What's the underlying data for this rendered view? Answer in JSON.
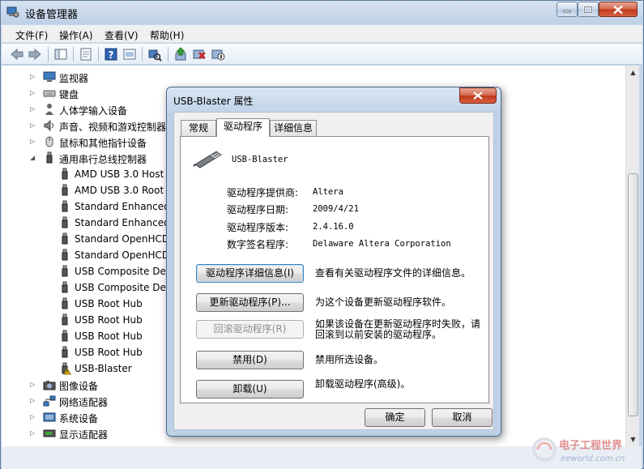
{
  "window": {
    "title": "设备管理器",
    "menu": [
      "文件(F)",
      "操作(A)",
      "查看(V)",
      "帮助(H)"
    ]
  },
  "tree": {
    "categories_top": [
      {
        "label": "监视器",
        "icon": "monitor-icon",
        "expanded": false
      },
      {
        "label": "键盘",
        "icon": "keyboard-icon",
        "expanded": false
      },
      {
        "label": "人体学输入设备",
        "icon": "hid-icon",
        "expanded": false
      },
      {
        "label": "声音、视频和游戏控制器",
        "icon": "sound-icon",
        "expanded": false
      },
      {
        "label": "鼠标和其他指针设备",
        "icon": "mouse-icon",
        "expanded": false
      },
      {
        "label": "通用串行总线控制器",
        "icon": "usb-controller-icon",
        "expanded": true
      }
    ],
    "usb_children": [
      "AMD USB 3.0 Host",
      "AMD USB 3.0 Root",
      "Standard Enhanced",
      "Standard Enhanced",
      "Standard OpenHCD",
      "Standard OpenHCD",
      "USB Composite Dev",
      "USB Composite Dev",
      "USB Root Hub",
      "USB Root Hub",
      "USB Root Hub",
      "USB Root Hub",
      "USB-Blaster"
    ],
    "categories_bottom": [
      {
        "label": "图像设备",
        "icon": "camera-icon"
      },
      {
        "label": "网络适配器",
        "icon": "network-icon"
      },
      {
        "label": "系统设备",
        "icon": "system-icon"
      },
      {
        "label": "显示适配器",
        "icon": "display-adapter-icon"
      }
    ]
  },
  "dialog": {
    "title": "USB-Blaster 属性",
    "tabs": [
      "常规",
      "驱动程序",
      "详细信息"
    ],
    "active_tab": "驱动程序",
    "device_name": "USB-Blaster",
    "fields": [
      {
        "label": "驱动程序提供商:",
        "value": "Altera"
      },
      {
        "label": "驱动程序日期:",
        "value": "2009/4/21"
      },
      {
        "label": "驱动程序版本:",
        "value": "2.4.16.0"
      },
      {
        "label": "数字签名程序:",
        "value": "Delaware Altera Corporation"
      }
    ],
    "actions": [
      {
        "button": "驱动程序详细信息(I)",
        "desc": "查看有关驱动程序文件的详细信息。",
        "enabled": true
      },
      {
        "button": "更新驱动程序(P)...",
        "desc": "为这个设备更新驱动程序软件。",
        "enabled": true
      },
      {
        "button": "回滚驱动程序(R)",
        "desc": "如果该设备在更新驱动程序时失败，请回滚到以前安装的驱动程序。",
        "enabled": false
      },
      {
        "button": "禁用(D)",
        "desc": "禁用所选设备。",
        "enabled": true
      },
      {
        "button": "卸载(U)",
        "desc": "卸载驱动程序(高级)。",
        "enabled": true
      }
    ],
    "ok": "确定",
    "cancel": "取消"
  },
  "watermark": {
    "text": "电子工程世界",
    "url_text": "eeworld.com.cn"
  }
}
